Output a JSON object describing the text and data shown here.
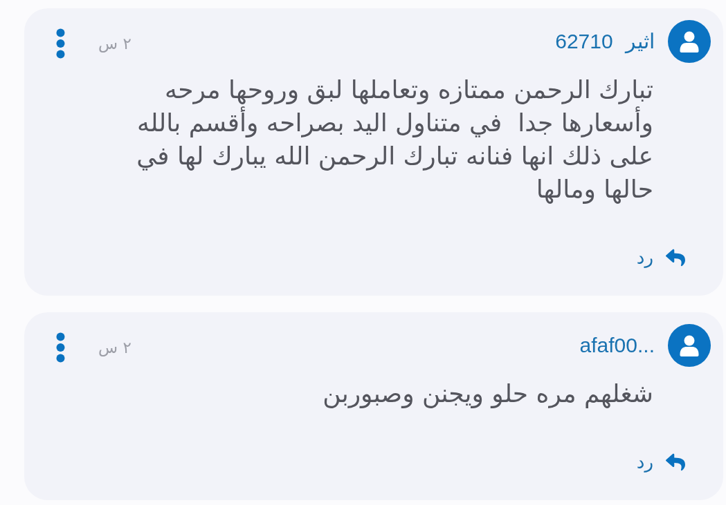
{
  "comments": [
    {
      "author": "اثير 62710",
      "time": "٢ س",
      "text": "تبارك الرحمن ممتازه وتعاملها لبق وروحها مرحه وأسعارها جدا  في متناول اليد بصراحه وأقسم بالله على ذلك انها فنانه تبارك الرحمن الله يبارك لها في حالها ومالها",
      "reply_label": "رد"
    },
    {
      "author": "afaf00...",
      "time": "٢ س",
      "text": "شغلهم مره حلو ويجنن وصبوربن",
      "reply_label": "رد"
    }
  ]
}
